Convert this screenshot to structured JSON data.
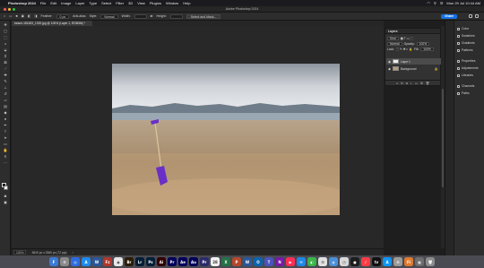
{
  "menubar": {
    "app_name": "Photoshop 2024",
    "items": [
      "File",
      "Edit",
      "Image",
      "Layer",
      "Type",
      "Select",
      "Filter",
      "3D",
      "View",
      "Plugins",
      "Window",
      "Help"
    ],
    "clock": "Mon 29 Jul  10:44 AM"
  },
  "window": {
    "title": "Adobe Photoshop 2024"
  },
  "options": {
    "feather_label": "Feather:",
    "feather_value": "0 px",
    "antialias_label": "Anti-alias",
    "style_label": "Style:",
    "style_value": "Normal",
    "width_label": "Width:",
    "height_label": "Height:",
    "select_mask_button": "Select and Mask...",
    "share_button": "Share"
  },
  "document": {
    "tab_label": "beach-181633_1920.jpg @ 100% (Layer 1, RGB/8#) *",
    "zoom": "100%",
    "status": "3840 px x 2560 px (72 ppi)"
  },
  "layers_panel": {
    "title": "Layers",
    "kind_label": "Kind",
    "blend_mode": "Normal",
    "opacity_label": "Opacity:",
    "opacity_value": "100%",
    "lock_label": "Lock:",
    "fill_label": "Fill:",
    "fill_value": "100%",
    "layers": [
      {
        "name": "Layer 1",
        "active": true
      },
      {
        "name": "Background",
        "active": false
      }
    ]
  },
  "right_panels": [
    "Color",
    "Swatches",
    "Gradients",
    "Patterns",
    "Properties",
    "Adjustments",
    "Libraries",
    "Channels",
    "Paths"
  ],
  "dock": {
    "apps": [
      {
        "label": "F",
        "color": "#3a7bd5"
      },
      {
        "label": "⚙",
        "color": "#8a8a8a"
      },
      {
        "label": "◎",
        "color": "#2b6de0"
      },
      {
        "label": "A",
        "color": "#1d8cf0"
      },
      {
        "label": "W",
        "color": "#2b579a"
      },
      {
        "label": "Fz",
        "color": "#b1362c"
      },
      {
        "label": "◉",
        "color": "#e8e8e8"
      },
      {
        "label": "Br",
        "color": "#2a1c06"
      },
      {
        "label": "Lr",
        "color": "#001e36"
      },
      {
        "label": "Ps",
        "color": "#001e36"
      },
      {
        "label": "Ai",
        "color": "#330000"
      },
      {
        "label": "Pr",
        "color": "#00005b"
      },
      {
        "label": "Ae",
        "color": "#00005b"
      },
      {
        "label": "Au",
        "color": "#00005b"
      },
      {
        "label": "Pr",
        "color": "#2b2b6b"
      },
      {
        "label": "28",
        "color": "#f2f2f2"
      },
      {
        "label": "X",
        "color": "#217346"
      },
      {
        "label": "P",
        "color": "#b7472a"
      },
      {
        "label": "W",
        "color": "#2b579a"
      },
      {
        "label": "O",
        "color": "#0a64ad"
      },
      {
        "label": "T",
        "color": "#4b53bc"
      },
      {
        "label": "N",
        "color": "#7719aa"
      },
      {
        "label": "▶",
        "color": "#ff2d55"
      },
      {
        "label": "✉",
        "color": "#1e88e5"
      },
      {
        "label": "◐",
        "color": "#3bb54a"
      },
      {
        "label": "☰",
        "color": "#e0e0e0"
      },
      {
        "label": "◍",
        "color": "#4a90d9"
      },
      {
        "label": "◷",
        "color": "#d9d9d9"
      },
      {
        "label": "●",
        "color": "#1c1c1c"
      },
      {
        "label": "♪",
        "color": "#fc3c44"
      },
      {
        "label": "tv",
        "color": "#111111"
      },
      {
        "label": "A",
        "color": "#0d96f6"
      },
      {
        "label": "⚙",
        "color": "#9b9b9b"
      },
      {
        "label": "Fi",
        "color": "#e07a2e"
      },
      {
        "label": "▦",
        "color": "#6e6e6e"
      },
      {
        "label": "🗑",
        "color": "#8c8c8c"
      }
    ]
  },
  "colors": {
    "accent": "#1473e6",
    "panel_bg": "#323232",
    "canvas_bg": "#282828"
  }
}
